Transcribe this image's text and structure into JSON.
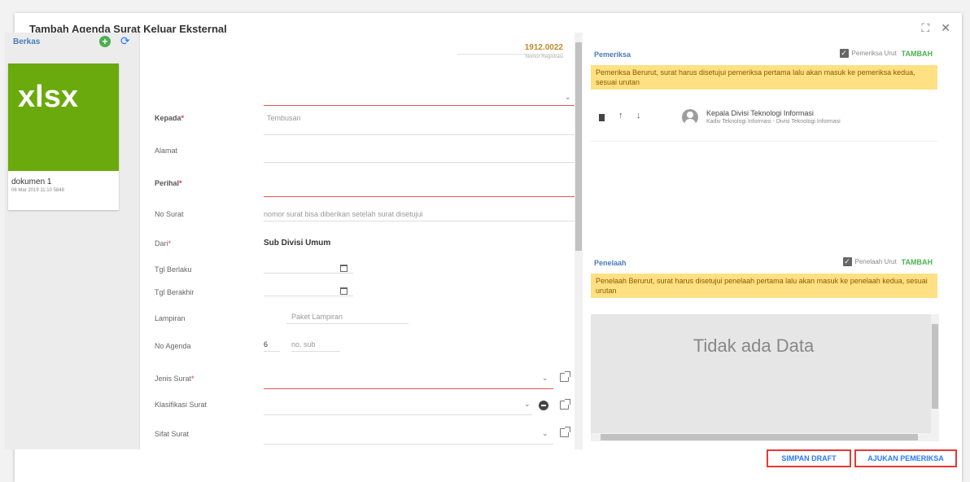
{
  "dialog": {
    "title": "Tambah Agenda Surat Keluar Eksternal",
    "fullscreen_icon": "⛶",
    "close_icon": "✕"
  },
  "berkas": {
    "title": "Berkas",
    "add_icon": "+",
    "refresh_icon": "⟳",
    "file": {
      "type": "xlsx",
      "name": "dokumen 1",
      "date": "06 Mar 2019 11:10 5848"
    }
  },
  "form": {
    "register_no": "1912.0022",
    "register_label": "Nomor Registrasi",
    "kepada_label": "Kepada",
    "tembusan_placeholder": "Tembusan",
    "alamat_label": "Alamat",
    "perihal_label": "Perihal",
    "no_surat_label": "No Surat",
    "no_surat_placeholder": "nomor surat bisa diberikan setelah surat disetujui",
    "dari_label": "Dari",
    "dari_value": "Sub Divisi Umum",
    "tgl_berlaku_label": "Tgl Berlaku",
    "tgl_berakhir_label": "Tgl Berakhir",
    "lampiran_label": "Lampiran",
    "lampiran_placeholder": "Paket Lampiran",
    "no_agenda_label": "No Agenda",
    "no_agenda_value": "6",
    "no_agenda_sub_placeholder": "no. sub",
    "jenis_surat_label": "Jenis Surat",
    "klasifikasi_label": "Klasifikasi Surat",
    "sifat_label": "Sifat Surat",
    "required_mark": "*",
    "caret": "⌄"
  },
  "pemeriksa": {
    "title": "Pemeriksa",
    "urut_label": "Pemeriksa Urut",
    "tambah": "TAMBAH",
    "info": "Pemeriksa Berurut, surat harus disetujui pemeriksa pertama lalu akan masuk ke pemeriksa kedua, sesuai urutan",
    "items": [
      {
        "name": "Kepala Divisi Teknologi Informasi",
        "role": "Kadiv Teknologi Informasi - Divisi Teknologi Informasi"
      }
    ]
  },
  "penelaah": {
    "title": "Penelaah",
    "urut_label": "Penelaah Urut",
    "tambah": "TAMBAH",
    "info": "Penelaah Berurut, surat harus disetujui penelaah pertama lalu akan masuk ke penelaah kedua, sesuai urutan",
    "empty": "Tidak ada Data"
  },
  "actions": {
    "simpan_draft": "SIMPAN DRAFT",
    "ajukan_pemeriksa": "AJUKAN PEMERIKSA"
  },
  "colors": {
    "accent": "#2979ff",
    "tambah": "#4caf50",
    "register": "#c08a2a",
    "warn_bg": "#ffe082",
    "xlsx_green": "#6aaa0c",
    "highlight_border": "#e53935"
  }
}
